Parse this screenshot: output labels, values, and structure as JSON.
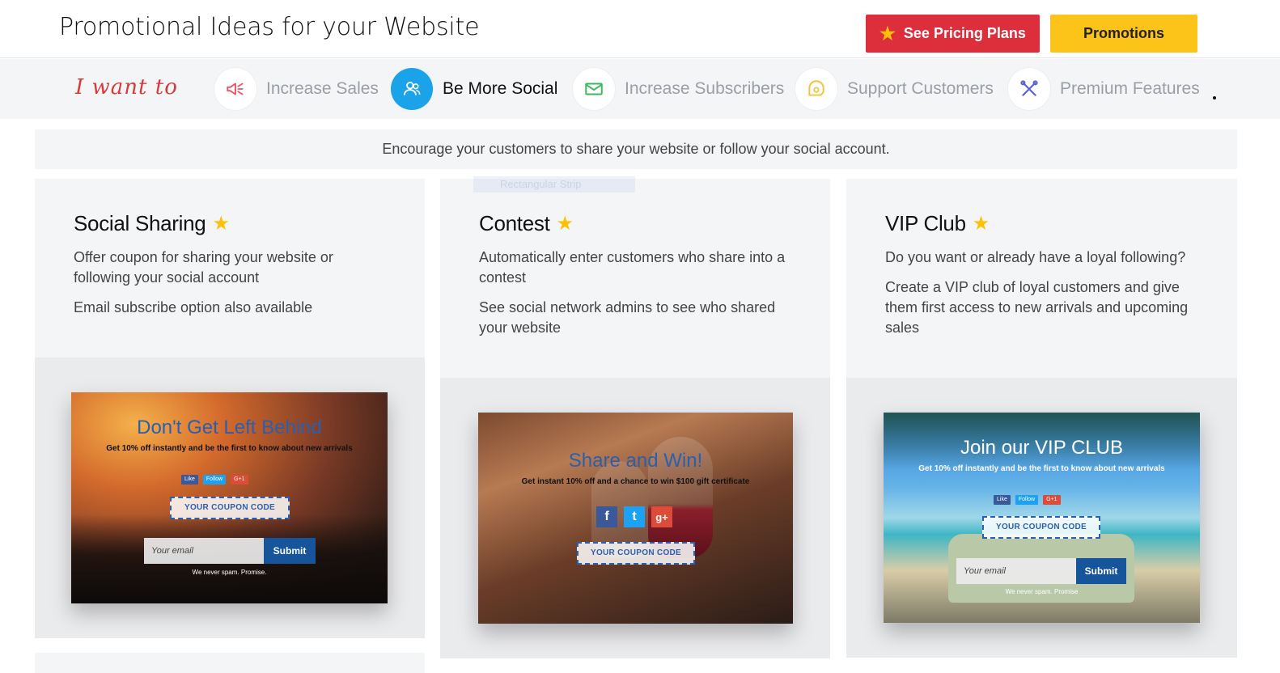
{
  "header": {
    "title": "Promotional Ideas for your Website",
    "pricing_label": "See Pricing Plans",
    "promotions_label": "Promotions"
  },
  "nav": {
    "prompt": "I want to",
    "items": [
      {
        "label": "Increase Sales",
        "icon": "megaphone-icon",
        "active": false
      },
      {
        "label": "Be More Social",
        "icon": "users-icon",
        "active": true
      },
      {
        "label": "Increase Subscribers",
        "icon": "envelope-icon",
        "active": false
      },
      {
        "label": "Support Customers",
        "icon": "chat-bubble-icon",
        "active": false
      },
      {
        "label": "Premium Features",
        "icon": "tools-icon",
        "active": false
      }
    ]
  },
  "description": "Encourage your customers to share your website or follow your social account.",
  "ghost_label": "Rectangular Strip",
  "cards": [
    {
      "title": "Social Sharing",
      "paragraphs": [
        "Offer coupon for sharing your website or following your social account",
        "Email subscribe option also available"
      ],
      "preview": {
        "title": "Don't Get Left Behind",
        "subtitle": "Get 10% off instantly and be the first to know about new arrivals",
        "social": [
          "Like",
          "Follow",
          "G+1"
        ],
        "coupon": "YOUR COUPON CODE",
        "email_placeholder": "Your email",
        "submit": "Submit",
        "nospam": "We never spam. Promise."
      }
    },
    {
      "title": "Contest",
      "paragraphs": [
        "Automatically enter customers who share into a contest",
        "See social network admins to see who shared your website"
      ],
      "preview": {
        "title": "Share and Win!",
        "subtitle": "Get instant 10% off and a chance to win $100 gift certificate",
        "social": [
          "f",
          "t",
          "g+"
        ],
        "coupon": "YOUR COUPON CODE"
      }
    },
    {
      "title": "VIP Club",
      "paragraphs": [
        "Do you want or already have a loyal following?",
        "Create a VIP club of loyal customers and give them first access to new arrivals and upcoming sales"
      ],
      "preview": {
        "title": "Join our VIP CLUB",
        "subtitle": "Get 10% off instantly and be the first to know about new arrivals",
        "social": [
          "Like",
          "Follow",
          "G+1"
        ],
        "coupon": "YOUR COUPON CODE",
        "email_placeholder": "Your email",
        "submit": "Submit",
        "nospam": "We never spam. Promise"
      }
    }
  ],
  "colors": {
    "pricing_button": "#dd2e3c",
    "promotions_button": "#fcc419",
    "active_nav": "#1aa3e8",
    "accent_text": "#d83a3a",
    "star": "#ffc107"
  }
}
